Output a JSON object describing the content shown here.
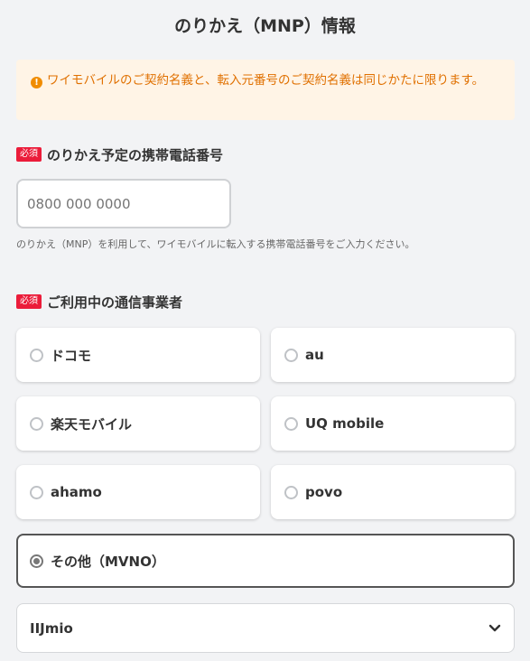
{
  "page": {
    "title": "のりかえ（MNP）情報"
  },
  "notice": {
    "icon": "info-icon",
    "icon_glyph": "!",
    "text": "ワイモバイルのご契約名義と、転入元番号のご契約名義は同じかたに限ります。"
  },
  "phone_section": {
    "required_badge": "必須",
    "label": "のりかえ予定の携帯電話番号",
    "input_placeholder": "0800 000 0000",
    "input_value": "",
    "hint": "のりかえ（MNP）を利用して、ワイモバイルに転入する携帯電話番号をご入力ください。"
  },
  "carrier_section": {
    "required_badge": "必須",
    "label": "ご利用中の通信事業者",
    "options": [
      {
        "label": "ドコモ",
        "selected": false
      },
      {
        "label": "au",
        "selected": false
      },
      {
        "label": "楽天モバイル",
        "selected": false
      },
      {
        "label": "UQ mobile",
        "selected": false
      },
      {
        "label": "ahamo",
        "selected": false
      },
      {
        "label": "povo",
        "selected": false
      },
      {
        "label": "その他（MVNO）",
        "selected": true
      }
    ],
    "mvno_select": {
      "value": "IIJmio",
      "icon": "chevron-down-icon"
    }
  },
  "colors": {
    "background": "#f2f3f5",
    "notice_bg": "#fff4e6",
    "notice_text": "#e07000",
    "required_badge": "#eb1c3a"
  }
}
